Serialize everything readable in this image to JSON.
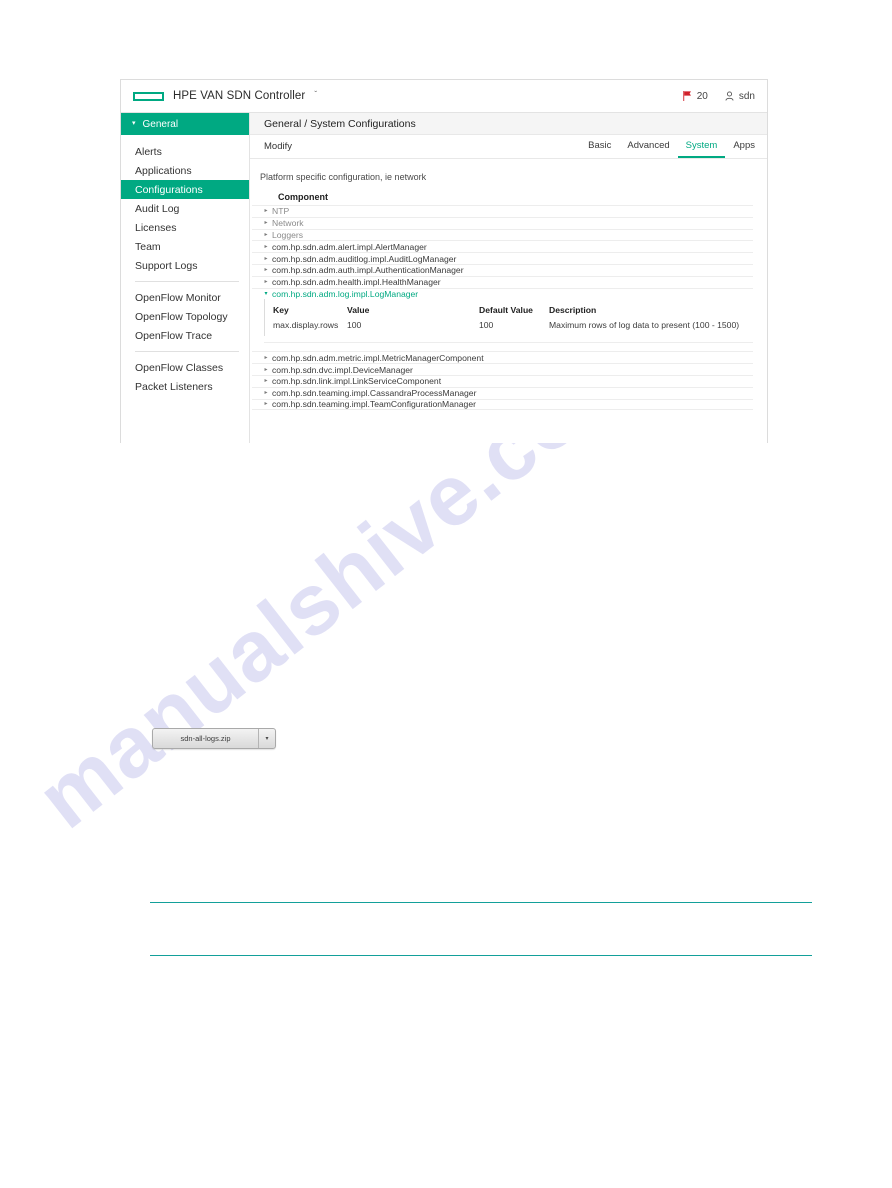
{
  "watermark": {
    "text": "manualshive.com"
  },
  "topbar": {
    "logo_icon": "hpe-logo-icon",
    "title": "HPE VAN SDN Controller",
    "title_caret": "ˇ",
    "alerts": {
      "icon": "flag-icon",
      "count": "20",
      "color": "#d1222b"
    },
    "user": {
      "icon": "person-icon",
      "name": "sdn"
    }
  },
  "sidebar": {
    "header": {
      "label": "General",
      "caret": "▾",
      "color": "#00a982"
    },
    "groups": [
      {
        "items": [
          {
            "label": "Alerts",
            "active": false
          },
          {
            "label": "Applications",
            "active": false
          },
          {
            "label": "Configurations",
            "active": true
          },
          {
            "label": "Audit Log",
            "active": false
          },
          {
            "label": "Licenses",
            "active": false
          },
          {
            "label": "Team",
            "active": false
          },
          {
            "label": "Support Logs",
            "active": false
          }
        ]
      },
      {
        "items": [
          {
            "label": "OpenFlow Monitor",
            "active": false
          },
          {
            "label": "OpenFlow Topology",
            "active": false
          },
          {
            "label": "OpenFlow Trace",
            "active": false
          }
        ]
      },
      {
        "items": [
          {
            "label": "OpenFlow Classes",
            "active": false
          },
          {
            "label": "Packet Listeners",
            "active": false
          }
        ]
      }
    ]
  },
  "content": {
    "breadcrumb": "General / System Configurations",
    "modify_label": "Modify",
    "tabs": [
      {
        "label": "Basic",
        "active": false
      },
      {
        "label": "Advanced",
        "active": false
      },
      {
        "label": "System",
        "active": true
      },
      {
        "label": "Apps",
        "active": false
      }
    ],
    "panel_description": "Platform specific configuration, ie network",
    "component_column_header": "Component",
    "components_before": [
      {
        "label": "NTP",
        "muted": true
      },
      {
        "label": "Network",
        "muted": true
      },
      {
        "label": "Loggers",
        "muted": true
      },
      {
        "label": "com.hp.sdn.adm.alert.impl.AlertManager",
        "muted": false
      },
      {
        "label": "com.hp.sdn.adm.auditlog.impl.AuditLogManager",
        "muted": false
      },
      {
        "label": "com.hp.sdn.adm.auth.impl.AuthenticationManager",
        "muted": false
      },
      {
        "label": "com.hp.sdn.adm.health.impl.HealthManager",
        "muted": false
      }
    ],
    "expanded_component": {
      "label": "com.hp.sdn.adm.log.impl.LogManager",
      "caret": "▾",
      "headers": {
        "key": "Key",
        "value": "Value",
        "default_value": "Default Value",
        "description": "Description"
      },
      "rows": [
        {
          "key": "max.display.rows",
          "value": "100",
          "default_value": "100",
          "description": "Maximum rows of log data to present (100 - 1500)"
        }
      ]
    },
    "components_after": [
      {
        "label": "com.hp.sdn.adm.metric.impl.MetricManagerComponent",
        "muted": false
      },
      {
        "label": "com.hp.sdn.dvc.impl.DeviceManager",
        "muted": false
      },
      {
        "label": "com.hp.sdn.link.impl.LinkServiceComponent",
        "muted": false
      },
      {
        "label": "com.hp.sdn.teaming.impl.CassandraProcessManager",
        "muted": false
      },
      {
        "label": "com.hp.sdn.teaming.impl.TeamConfigurationManager",
        "muted": false
      }
    ],
    "row_collapsed_caret": "▸"
  },
  "download_chip": {
    "filename": "sdn-all-logs.zip",
    "caret": "▾"
  },
  "colors": {
    "accent_green": "#00a982",
    "rule_teal": "#13a09a",
    "alert_red": "#d1222b",
    "watermark": "#c8c8ee"
  }
}
